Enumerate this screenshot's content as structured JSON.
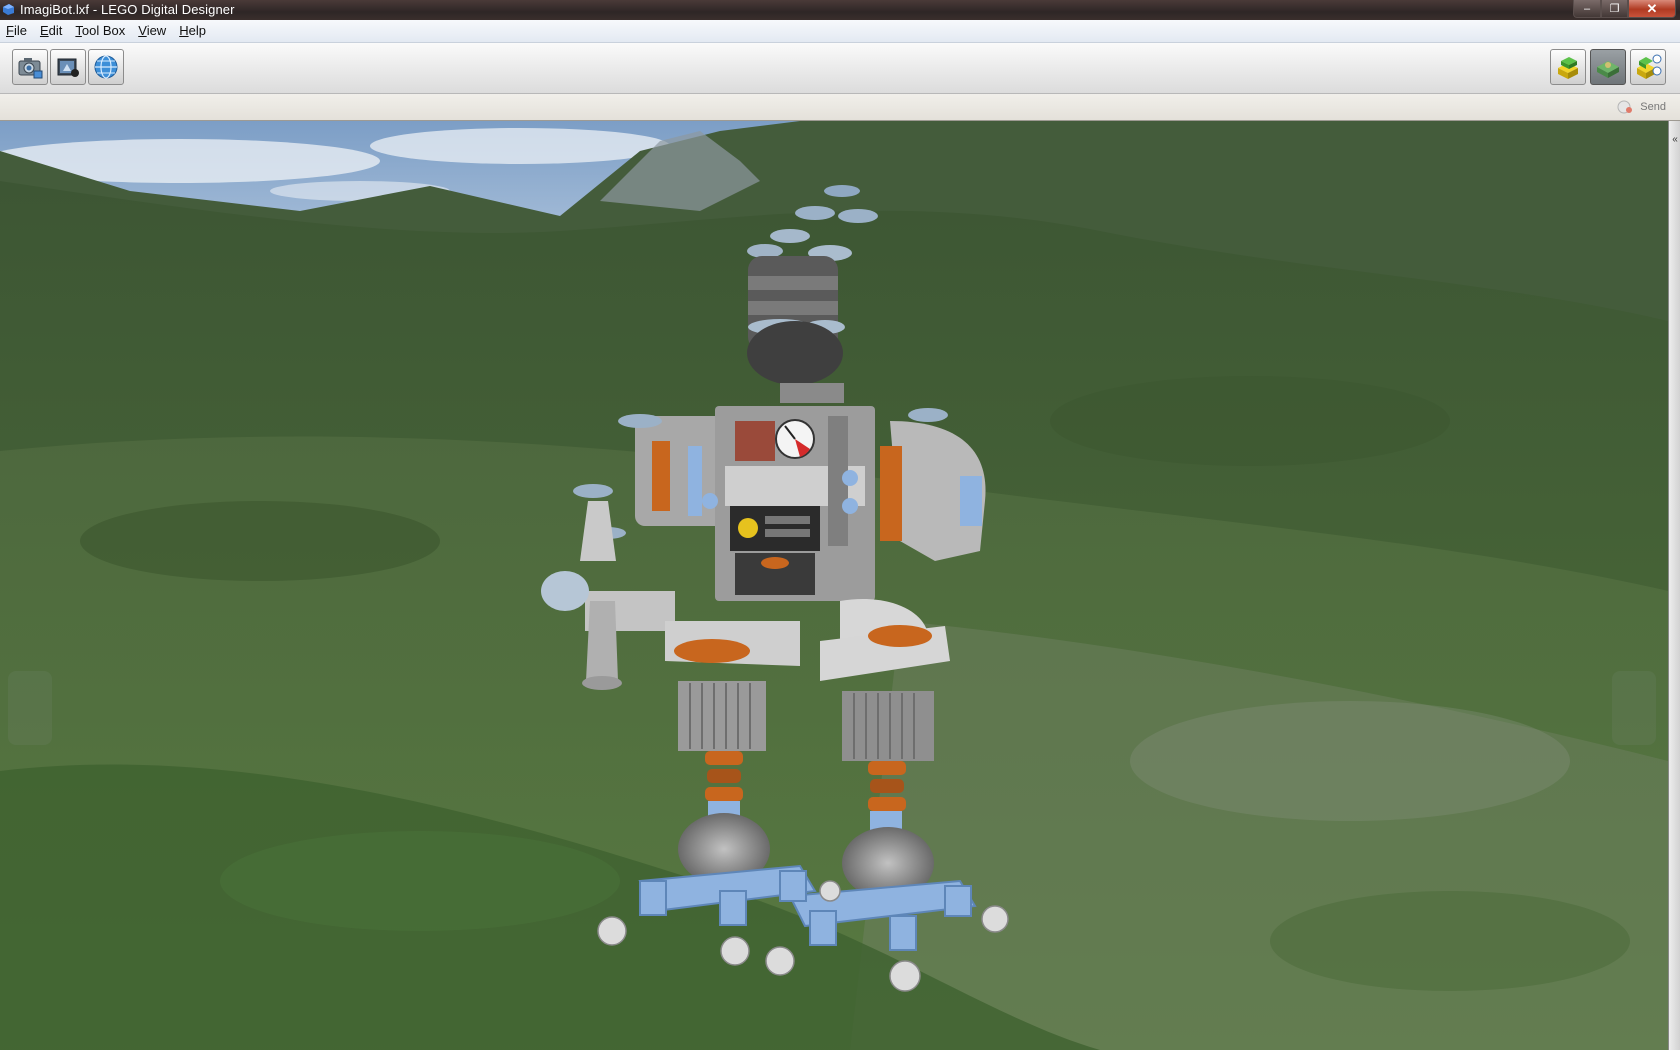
{
  "window": {
    "title": "ImagiBot.lxf - LEGO Digital Designer",
    "controls": {
      "minimize": "–",
      "maximize": "❐",
      "close": "✕"
    }
  },
  "menu": {
    "items": [
      {
        "label": "File",
        "accel": "F"
      },
      {
        "label": "Edit",
        "accel": "E"
      },
      {
        "label": "Tool Box",
        "accel": "T"
      },
      {
        "label": "View",
        "accel": "V"
      },
      {
        "label": "Help",
        "accel": "H"
      }
    ]
  },
  "toolbar": {
    "left_icons": [
      "camera-screenshot-icon",
      "build-instructions-icon",
      "globe-share-icon"
    ],
    "right_icons": [
      "build-mode-icon",
      "view-mode-icon",
      "building-guide-mode-icon"
    ],
    "active_right": "view-mode-icon"
  },
  "sendbar": {
    "send_label": "Send"
  },
  "scene": {
    "model": "robot-model",
    "background": "mountain-landscape"
  },
  "colors": {
    "brick_gray": "#9a9a9a",
    "brick_orange": "#c8661e",
    "brick_light_blue": "#8fb3e0",
    "grass": "#4d6b36",
    "sky": "#8fb0d3"
  }
}
